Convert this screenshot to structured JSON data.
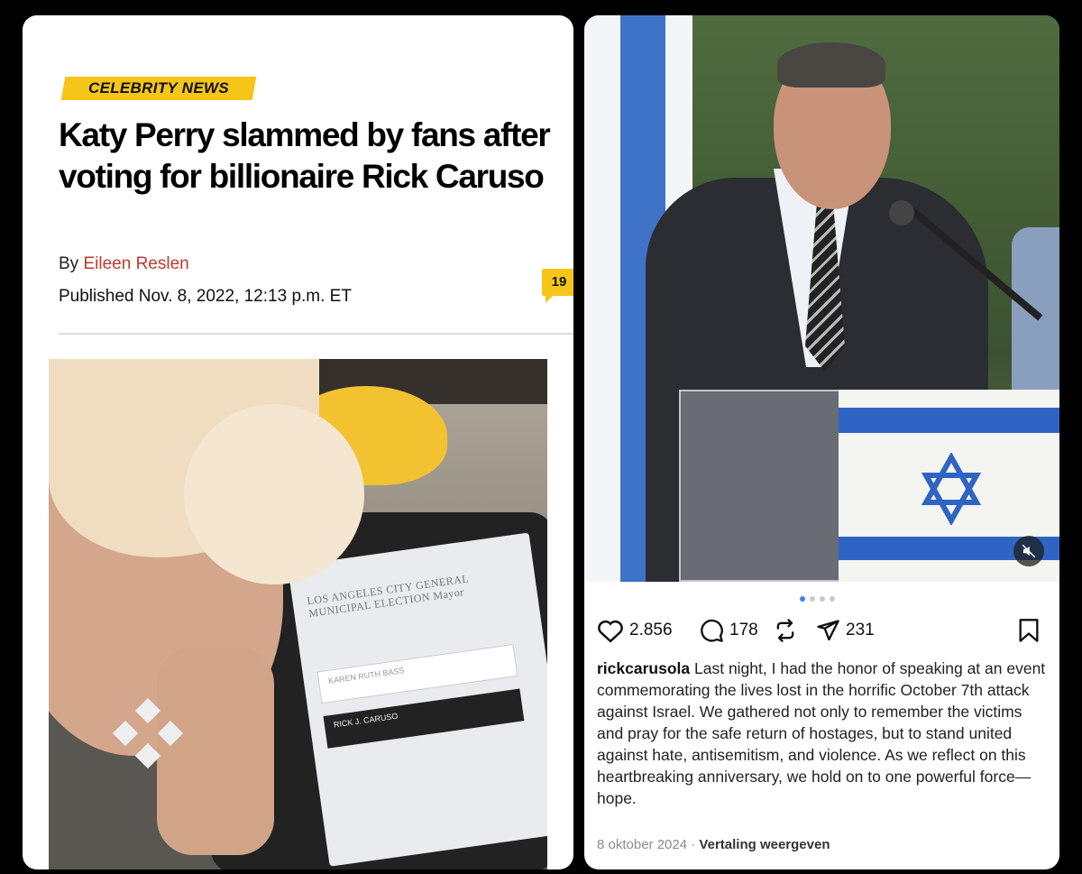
{
  "article": {
    "category": "CELEBRITY NEWS",
    "headline": "Katy Perry slammed by fans after voting for billionaire Rick Caruso",
    "by_prefix": "By",
    "author": "Eileen Reslen",
    "published": "Published Nov. 8, 2022, 12:13 p.m. ET",
    "comment_count": "19",
    "photo": {
      "ballot_title": "LOS ANGELES CITY GENERAL MUNICIPAL ELECTION Mayor",
      "candidate_1": "KAREN RUTH BASS",
      "candidate_2": "RICK J. CARUSO"
    },
    "colors": {
      "tag": "#f5c518",
      "author": "#c0392b"
    }
  },
  "instagram": {
    "likes": "2.856",
    "comments": "178",
    "shares": "231",
    "username": "rickcarusola",
    "caption": "Last night, I had the honor of speaking at an event commemorating the lives lost in the horrific October 7th attack against Israel. We gathered not only to remember the victims and pray for the safe return of hostages, but to stand united against hate, antisemitism, and violence. As we reflect on this heartbreaking anniversary, we hold on to one powerful force—hope.",
    "date": "8 oktober 2024",
    "separator": "·",
    "translate_label": "Vertaling weergeven",
    "icons": [
      "heart-icon",
      "comment-icon",
      "repost-icon",
      "share-icon",
      "bookmark-icon",
      "mute-icon"
    ],
    "carousel": {
      "count": 4,
      "active_index": 0
    },
    "colors": {
      "flag_blue": "#2f64c4",
      "carousel_active": "#3b82f6"
    }
  }
}
